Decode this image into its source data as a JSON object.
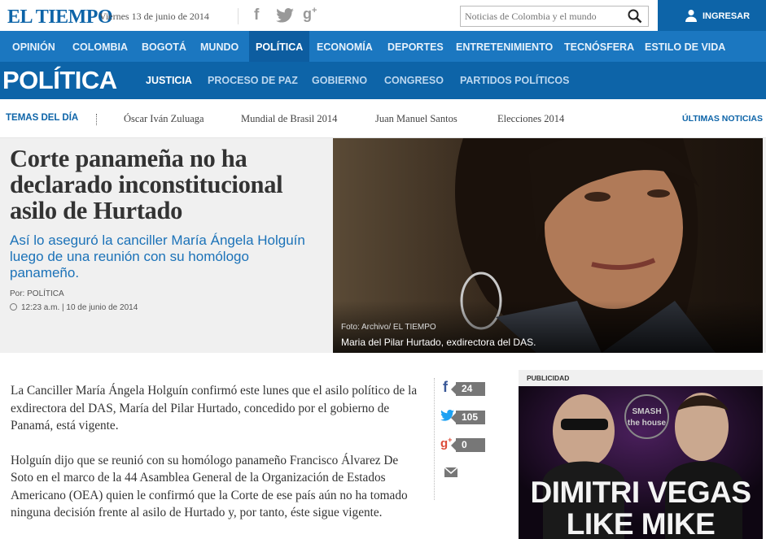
{
  "brand": {
    "logo": "EL TIEMPO",
    "date": "Viernes 13 de junio de 2014",
    "color": "#0d64a8"
  },
  "search": {
    "placeholder": "Noticias de Colombia y el mundo"
  },
  "login": {
    "label": "INGRESAR"
  },
  "nav": {
    "items": [
      "OPINIÓN",
      "COLOMBIA",
      "BOGOTÁ",
      "MUNDO",
      "POLÍTICA",
      "ECONOMÍA",
      "DEPORTES",
      "ENTRETENIMIENTO",
      "TECNÓSFERA",
      "ESTILO DE VIDA"
    ],
    "active": "POLÍTICA"
  },
  "section": {
    "title": "POLÍTICA",
    "subnav": [
      "JUSTICIA",
      "PROCESO DE PAZ",
      "GOBIERNO",
      "CONGRESO",
      "PARTIDOS POLÍTICOS"
    ],
    "active": "JUSTICIA"
  },
  "topics": {
    "label": "TEMAS DEL DÍA",
    "items": [
      "Óscar Iván Zuluaga",
      "Mundial de Brasil 2014",
      "Juan Manuel Santos",
      "Elecciones 2014"
    ],
    "latest": "ÚLTIMAS NOTICIAS"
  },
  "article": {
    "headline": "Corte panameña no ha declarado inconstitucional asilo de Hurtado",
    "subhead": "Así lo aseguró la canciller María Ángela Holguín luego de una reunión con su homólogo panameño.",
    "byline": "Por: POLÍTICA",
    "timestamp": "12:23 a.m. | 10 de junio de 2014",
    "photo_credit": "Foto: Archivo/ EL TIEMPO",
    "photo_caption": "Maria del Pilar Hurtado, exdirectora del DAS.",
    "paragraphs": [
      "La Canciller María Ángela Holguín confirmó este lunes que el asilo político de la exdirectora del DAS, María del Pilar Hurtado, concedido por el gobierno de Panamá, está vigente.",
      "Holguín dijo que se reunió con su homólogo panameño Francisco Álvarez De Soto en el marco de la 44 Asamblea General de la Organización de Estados Americano (OEA) quien le confirmó que la Corte de ese país aún no ha tomado ninguna decisión frente al asilo de Hurtado y, por tanto, éste sigue vigente."
    ]
  },
  "share": {
    "facebook": "24",
    "twitter": "105",
    "googleplus": "0"
  },
  "ad": {
    "label": "PUBLICIDAD",
    "badge": "SMASH the house",
    "line1": "DIMITRI VEGAS",
    "line2": "LIKE MIKE"
  }
}
